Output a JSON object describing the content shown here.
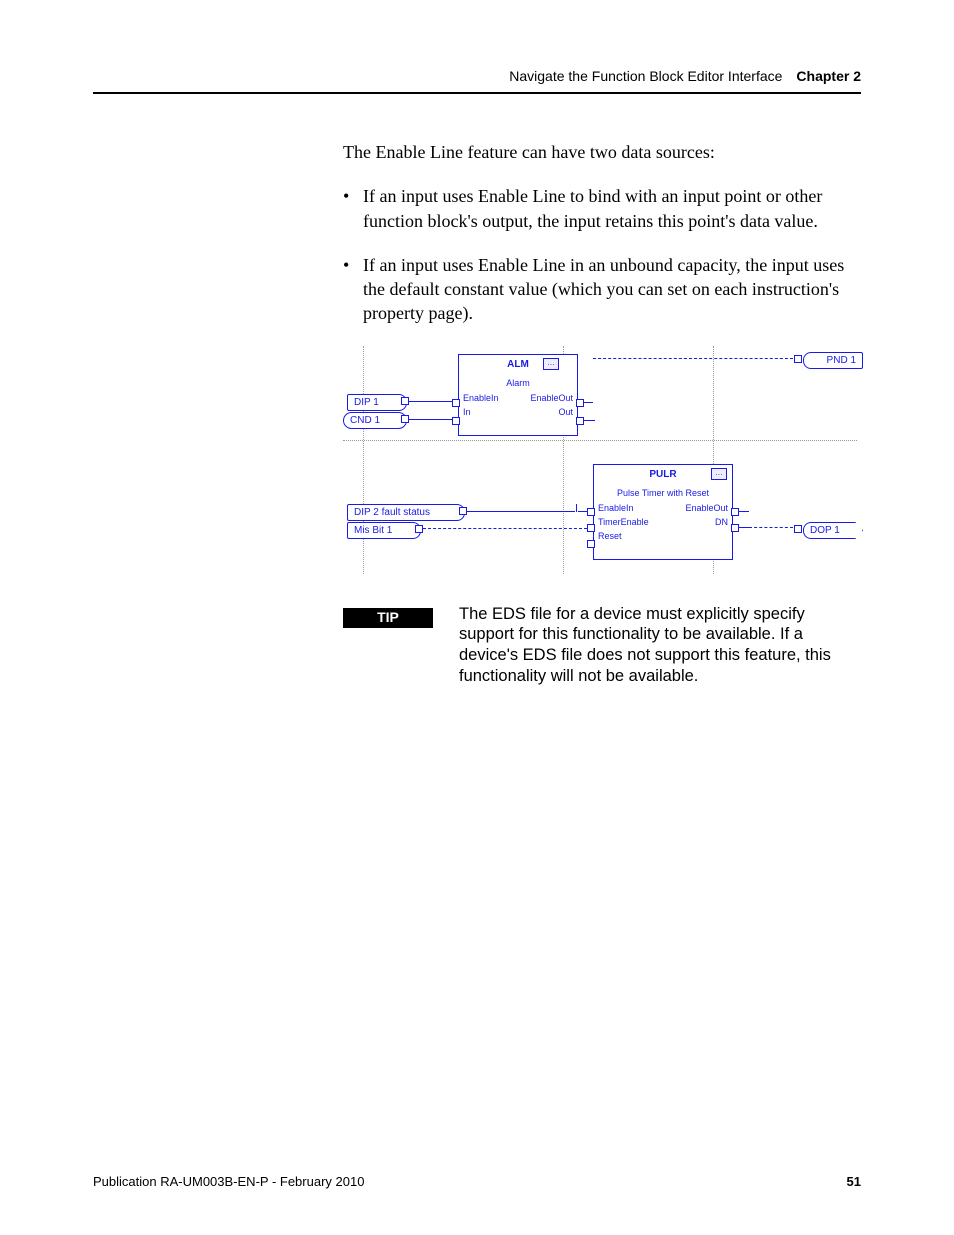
{
  "header": {
    "title": "Navigate the Function Block Editor Interface",
    "chapter_label": "Chapter 2"
  },
  "body": {
    "intro": "The Enable Line feature can have two data sources:",
    "bullets": [
      "If an input uses Enable Line to bind with an input point or other function block's output, the input retains this point's data value.",
      "If an input uses Enable Line in an unbound capacity, the input uses the default constant value (which you can set on each instruction's property page)."
    ]
  },
  "figure": {
    "blocks": {
      "alm": {
        "name": "ALM",
        "subtitle": "Alarm",
        "ports_left": [
          "EnableIn",
          "In"
        ],
        "ports_right": [
          "EnableOut",
          "Out"
        ]
      },
      "pulr": {
        "name": "PULR",
        "subtitle": "Pulse Timer with Reset",
        "ports_left": [
          "EnableIn",
          "TimerEnable",
          "Reset"
        ],
        "ports_right": [
          "EnableOut",
          "DN"
        ]
      }
    },
    "tags": {
      "dip1": "DIP 1",
      "cnd1": "CND 1",
      "pnd1": "PND 1",
      "dip2": "DIP 2 fault status",
      "misbit1": "Mis Bit 1",
      "dop1": "DOP 1"
    }
  },
  "tip": {
    "label": "TIP",
    "text": "The EDS file for a device must explicitly specify support for this functionality to be available. If a device's EDS file does not support this feature, this functionality will not be available."
  },
  "footer": {
    "publication": "Publication RA-UM003B-EN-P - February 2010",
    "page": "51"
  }
}
